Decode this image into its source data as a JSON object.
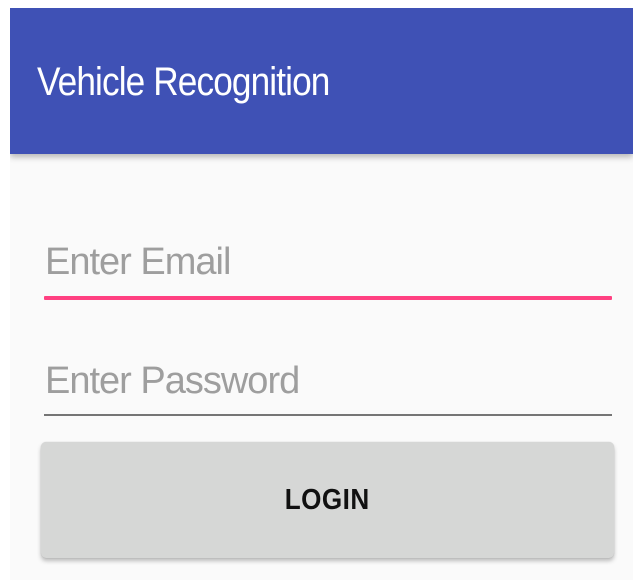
{
  "app_bar": {
    "title": "Vehicle Recognition",
    "color": "#3f51b5"
  },
  "form": {
    "email": {
      "placeholder": "Enter Email",
      "value": "",
      "focused": true
    },
    "password": {
      "placeholder": "Enter Password",
      "value": ""
    },
    "login_label": "LOGIN"
  },
  "colors": {
    "accent": "#ff4081",
    "button": "#d6d7d6",
    "background": "#fafafa"
  }
}
